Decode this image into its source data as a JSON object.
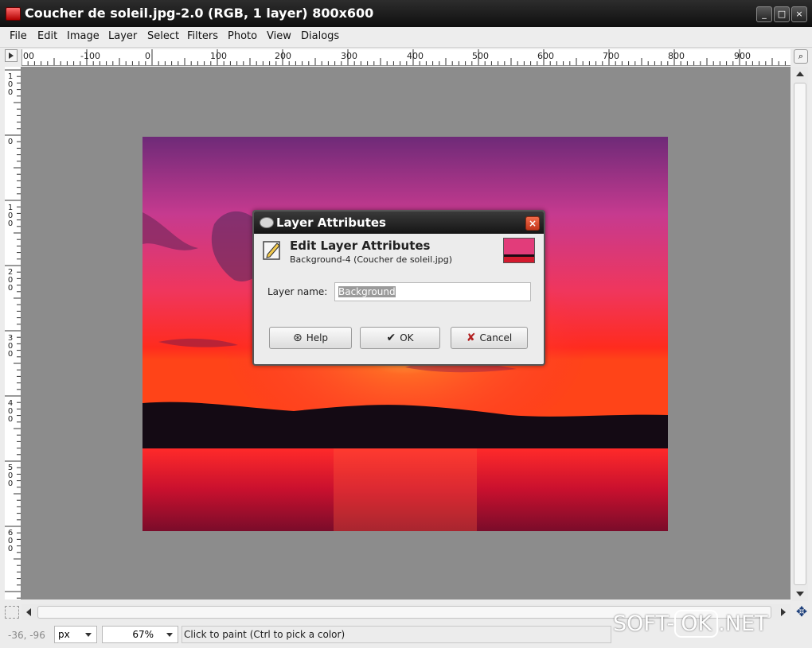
{
  "window": {
    "title": "Coucher de soleil.jpg-2.0 (RGB, 1 layer) 800x600",
    "controls": [
      "_",
      "□",
      "×"
    ]
  },
  "menu": [
    "File",
    "Edit",
    "Image",
    "Layer",
    "Select",
    "Filters",
    "Photo",
    "View",
    "Dialogs"
  ],
  "rulers": {
    "horizontal": [
      "00",
      "-100",
      "0",
      "100",
      "200",
      "300",
      "400",
      "500",
      "600",
      "700",
      "800",
      "900"
    ],
    "vertical": [
      "1\n0\n0",
      "0",
      "1\n0\n0",
      "2\n0\n0",
      "3\n0\n0",
      "4\n0\n0",
      "5\n0\n0",
      "6\n0\n0"
    ]
  },
  "dialog": {
    "title": "Layer Attributes",
    "heading": "Edit Layer Attributes",
    "subtitle": "Background-4 (Coucher de soleil.jpg)",
    "field_label": "Layer name:",
    "field_value": "Background",
    "buttons": {
      "help": "Help",
      "ok": "OK",
      "cancel": "Cancel"
    }
  },
  "status": {
    "coords": "-36, -96",
    "units": "px",
    "zoom": "67%",
    "message": "Click to paint (Ctrl to pick a color)"
  },
  "watermark": {
    "left": "SOFT-",
    "box": "OK",
    "right": ".NET"
  },
  "colors": {
    "canvas_bg": "#8c8c8c",
    "sky_top": "#7a2b7d",
    "sky_mid": "#e73c86",
    "horizon": "#ff3b24",
    "water": "#d8162a"
  },
  "icons": [
    "app-icon",
    "edit-pencil-icon",
    "help-icon",
    "ok-icon",
    "cancel-icon",
    "move-icon",
    "ruler-corner-icon",
    "navigate-icon"
  ]
}
